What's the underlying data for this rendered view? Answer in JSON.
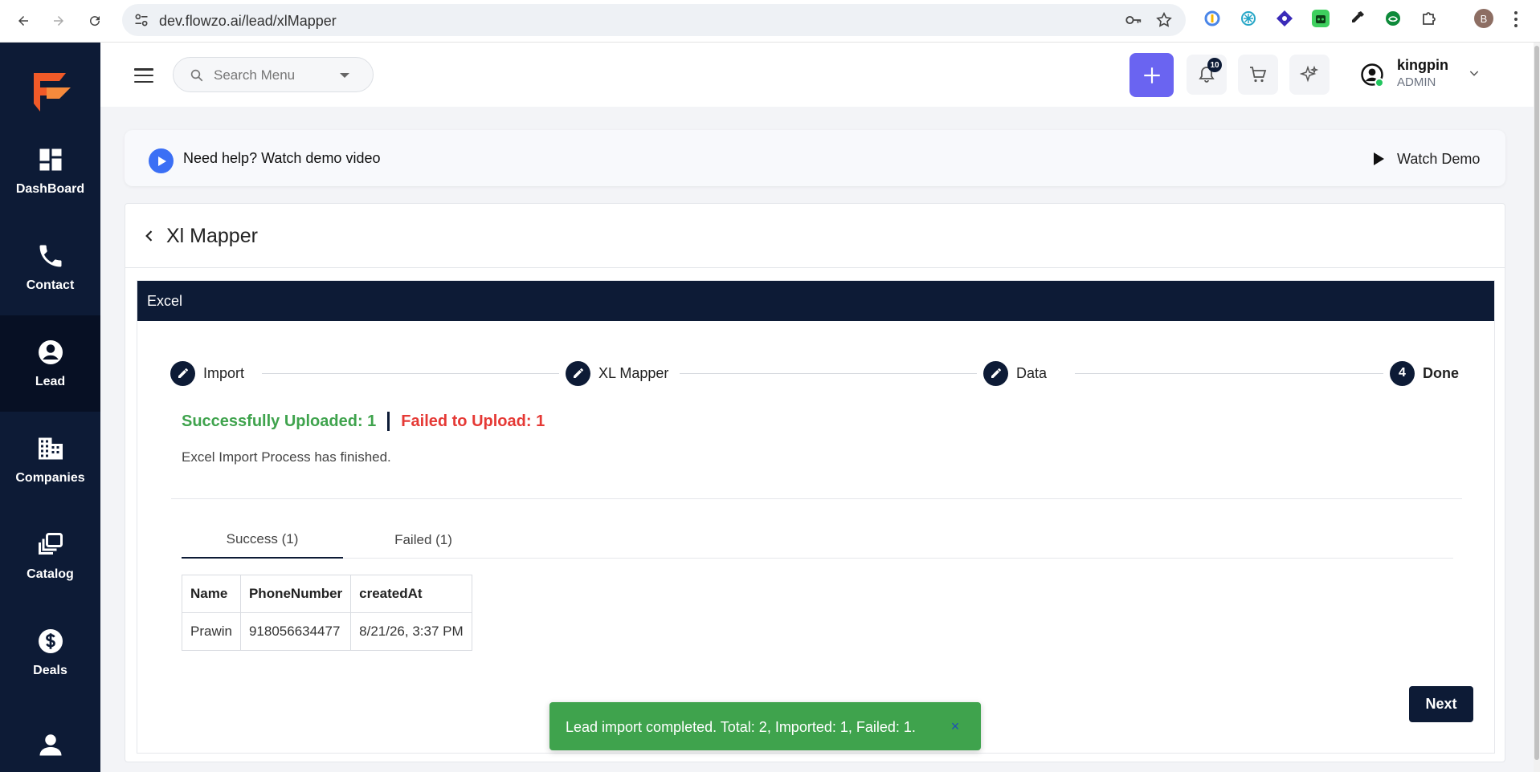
{
  "browser": {
    "url": "dev.flowzo.ai/lead/xlMapper",
    "profile_initial": "B"
  },
  "sidebar": {
    "items": [
      {
        "label": "DashBoard",
        "icon": "dashboard-icon"
      },
      {
        "label": "Contact",
        "icon": "phone-icon"
      },
      {
        "label": "Lead",
        "icon": "account-circle-icon",
        "active": true
      },
      {
        "label": "Companies",
        "icon": "building-icon"
      },
      {
        "label": "Catalog",
        "icon": "catalog-icon"
      },
      {
        "label": "Deals",
        "icon": "dollar-icon"
      },
      {
        "label": "",
        "icon": "person-icon"
      }
    ]
  },
  "header": {
    "search_placeholder": "Search Menu",
    "notification_count": "10",
    "user": {
      "name": "kingpin",
      "role": "ADMIN"
    }
  },
  "help_banner": {
    "text": "Need help? Watch demo video",
    "watch_demo_label": "Watch Demo"
  },
  "page": {
    "title": "Xl Mapper",
    "section_title": "Excel"
  },
  "stepper": {
    "steps": [
      {
        "label": "Import",
        "marker": "edit-icon"
      },
      {
        "label": "XL Mapper",
        "marker": "edit-icon"
      },
      {
        "label": "Data",
        "marker": "edit-icon"
      },
      {
        "label": "Done",
        "marker": "4"
      }
    ]
  },
  "summary": {
    "success_text": "Successfully Uploaded: 1",
    "failed_text": "Failed to Upload: 1",
    "process_message": "Excel Import Process has finished."
  },
  "tabs": [
    {
      "label": "Success (1)",
      "active": true
    },
    {
      "label": "Failed (1)",
      "active": false
    }
  ],
  "table": {
    "headers": [
      "Name",
      "PhoneNumber",
      "createdAt"
    ],
    "rows": [
      [
        "Prawin",
        "918056634477",
        "8/21/26, 3:37 PM"
      ]
    ]
  },
  "next_label": "Next",
  "toast": {
    "message": "Lead import completed. Total: 2, Imported: 1, Failed: 1.",
    "close": "×"
  },
  "colors": {
    "navy": "#0d1b36",
    "accent": "#6a64f1",
    "success": "#3fa34d",
    "danger": "#e53935"
  }
}
